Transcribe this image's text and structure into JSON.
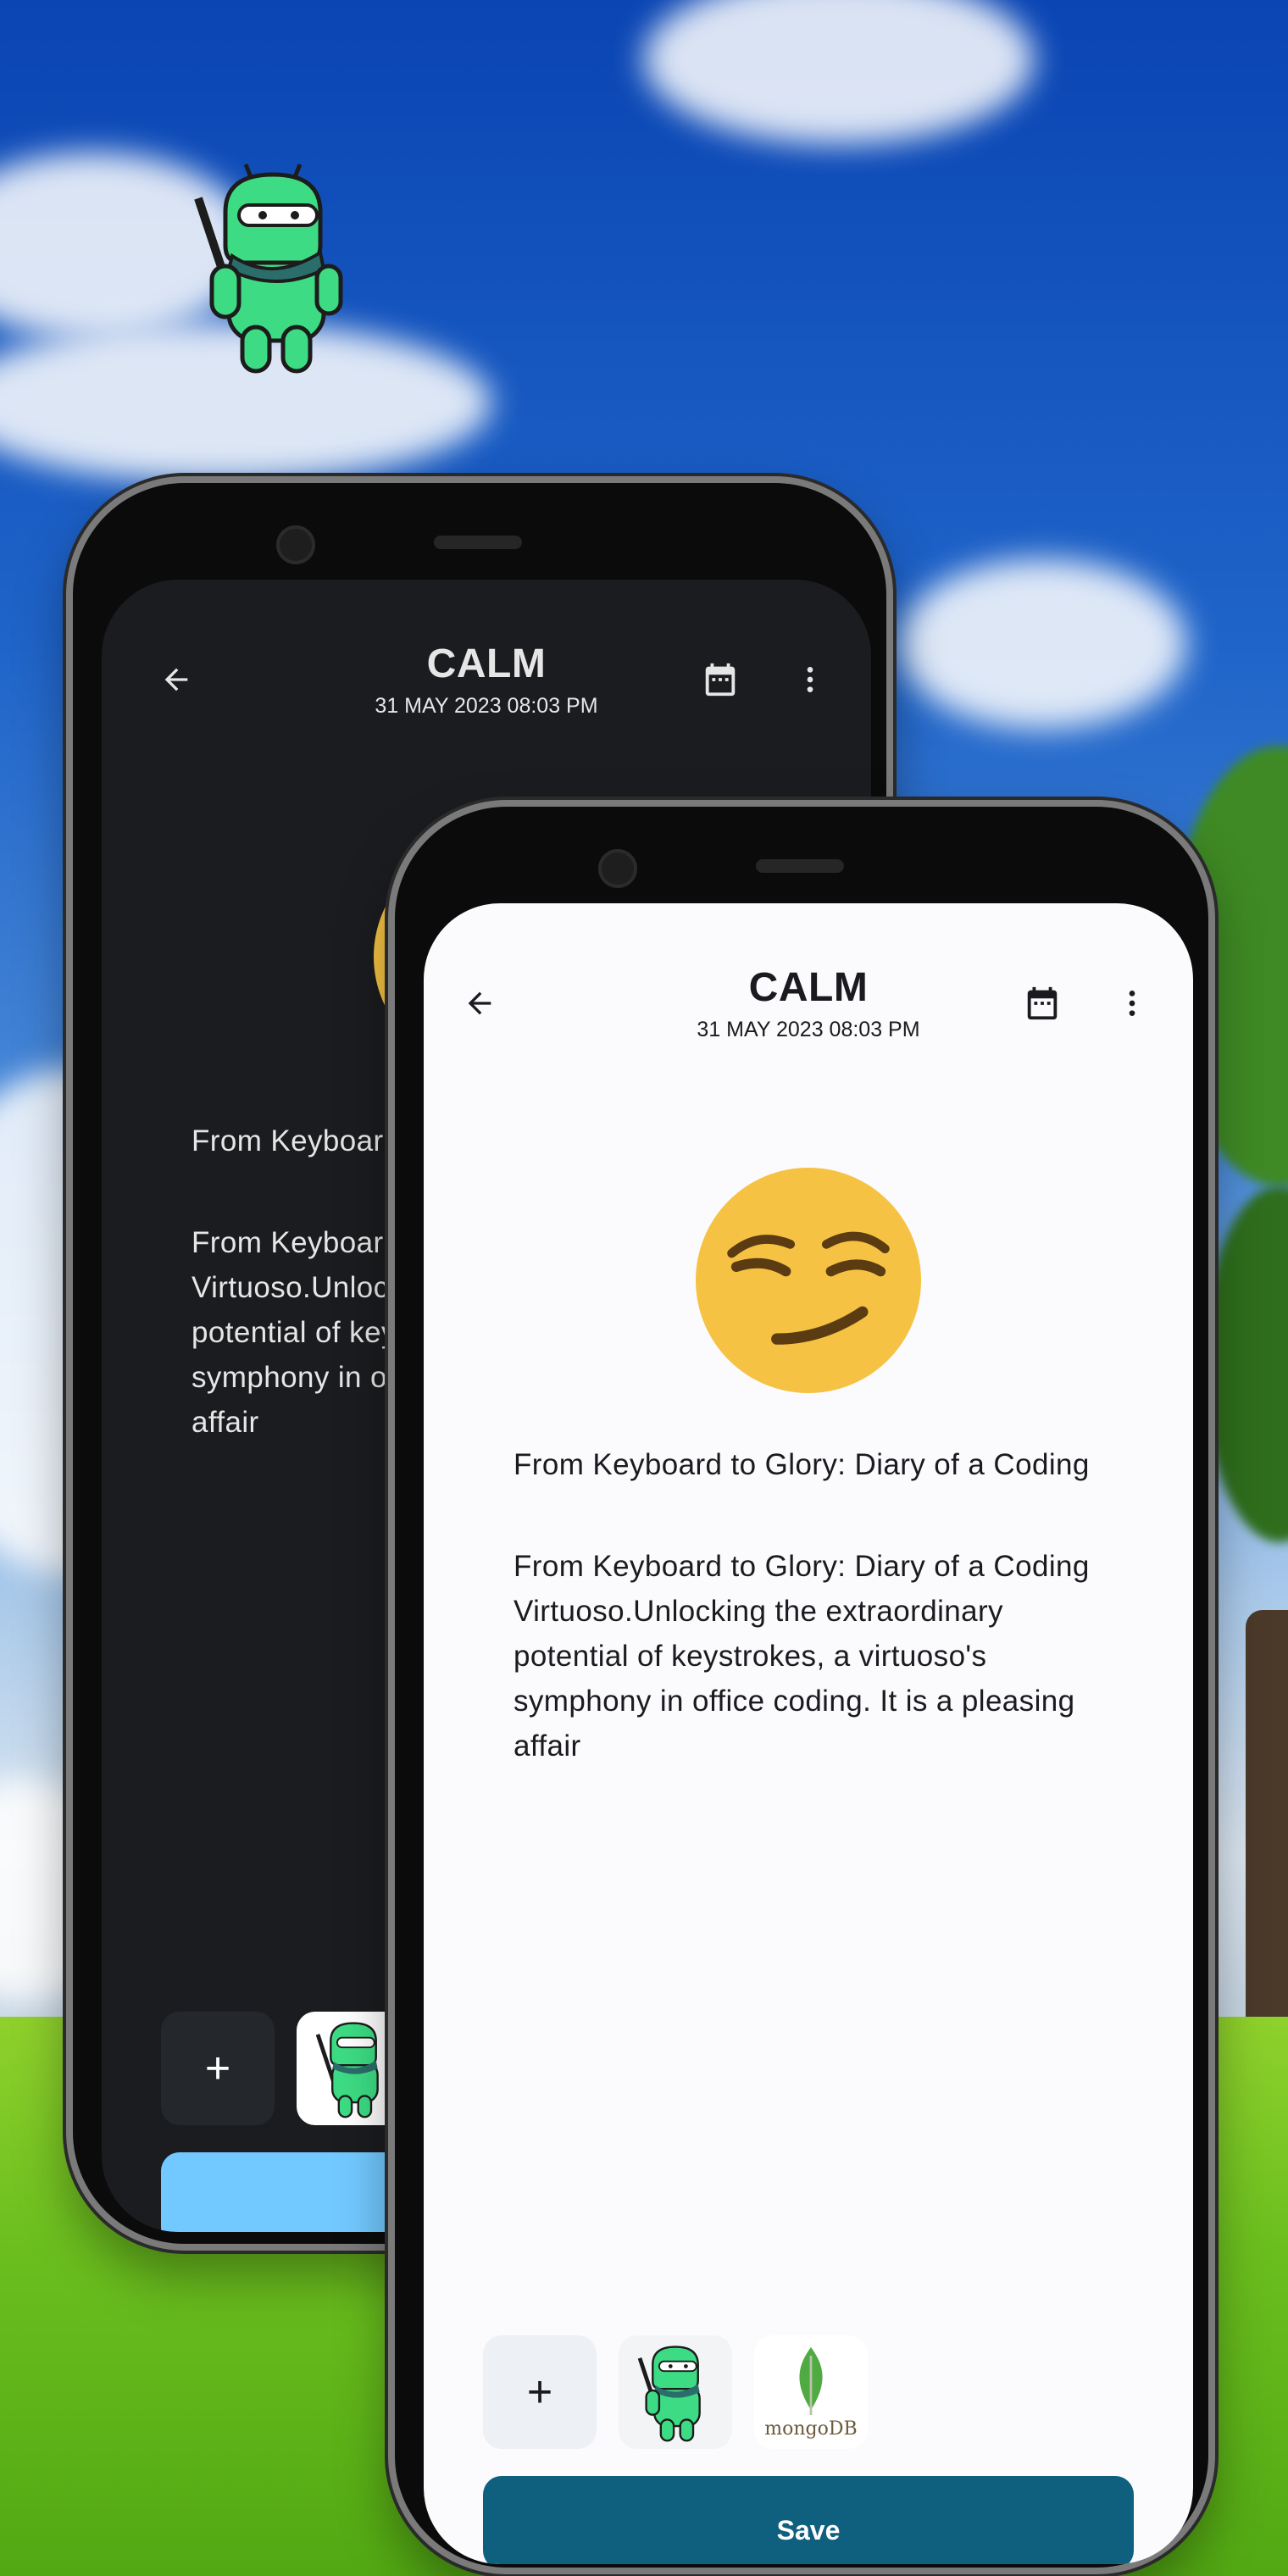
{
  "app": {
    "title": "CALM",
    "datetime": "31 MAY 2023 08:03 PM",
    "entry_heading": "From Keyboard to Glory: Diary of a Coding",
    "entry_body": "From Keyboard to Glory: Diary of a Coding Virtuoso.Unlocking the extraordinary potential of keystrokes, a virtuoso's symphony in office coding. It is a pleasing affair",
    "mood_emoji": "smirking-face",
    "add_attachment_label": "+",
    "save_label": "Save",
    "attachments": [
      {
        "name": "android-mascot-thumbnail"
      },
      {
        "name": "mongodb-logo-thumbnail",
        "logo_text": "mongoDB"
      }
    ],
    "icons": {
      "back": "arrow-left-icon",
      "calendar": "calendar-icon",
      "more": "more-vert-icon"
    }
  },
  "theme": {
    "dark_surface": "#1b1c1f",
    "light_surface": "#fbfbfe",
    "save_dark": "#72c9ff",
    "save_light": "#0f5f7e",
    "emoji_yellow": "#f5c243"
  }
}
